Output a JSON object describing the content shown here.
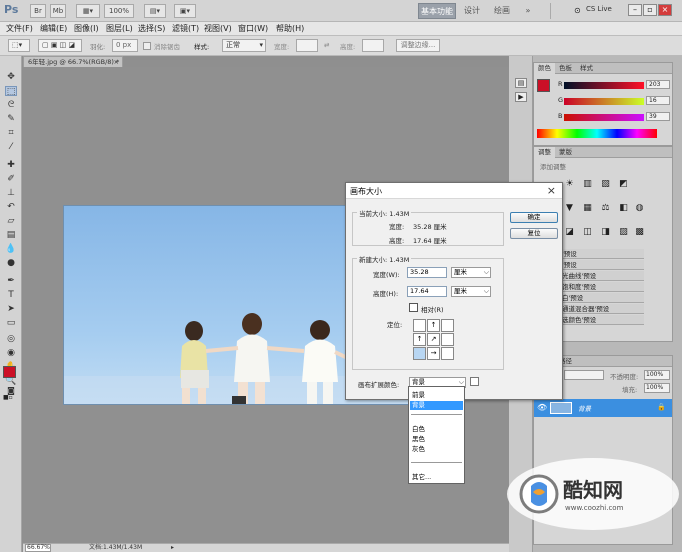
{
  "app": {
    "logo": "Ps",
    "zoom_preset": "100%",
    "workspace_tabs": [
      "基本功能",
      "设计",
      "绘画"
    ],
    "active_workspace": "基本功能",
    "cs_live": "CS Live"
  },
  "menu": [
    "文件(F)",
    "编辑(E)",
    "图像(I)",
    "图层(L)",
    "选择(S)",
    "滤镜(T)",
    "视图(V)",
    "窗口(W)",
    "帮助(H)"
  ],
  "options": {
    "feather_label": "羽化:",
    "feather_value": "0 px",
    "antialias_label": "消除锯齿",
    "style_label": "样式:",
    "style_value": "正常",
    "width_label": "宽度:",
    "height_label": "高度:",
    "refine_edge": "调整边缘..."
  },
  "document": {
    "tab_title": "6年轻.jpg @ 66.7%(RGB/8) *",
    "zoom": "66.67%",
    "status": "文档:1.43M/1.43M"
  },
  "panels": {
    "color_tabs": [
      "颜色",
      "色板",
      "样式"
    ],
    "rgb": [
      "203",
      "16",
      "39"
    ],
    "adjust_tabs": [
      "调整",
      "蒙版"
    ],
    "adjust_title": "添加调整",
    "presets": [
      "'预设",
      "'预设",
      "光曲线'预设",
      "饱和度'预设",
      "白'预设",
      "通道混合器'预设",
      "选颜色'预设"
    ],
    "layers_tabs": [
      "图层",
      "路径"
    ],
    "opacity_label": "不透明度:",
    "opacity_value": "100%",
    "fill_label": "填充:",
    "fill_value": "100%",
    "layer_name": "背景"
  },
  "dialog": {
    "title": "画布大小",
    "current_size": "当前大小: 1.43M",
    "current_width_label": "宽度:",
    "current_width_value": "35.28 厘米",
    "current_height_label": "高度:",
    "current_height_value": "17.64 厘米",
    "new_size": "新建大小: 1.43M",
    "width_label": "宽度(W):",
    "width_value": "35.28",
    "height_label": "高度(H):",
    "height_value": "17.64",
    "unit": "厘米",
    "relative_label": "相对(R)",
    "anchor_label": "定位:",
    "ok": "确定",
    "reset": "复位",
    "ext_color_label": "画布扩展颜色:",
    "ext_color_value": "背景"
  },
  "dropdown_options": [
    "前景",
    "背景",
    "白色",
    "黑色",
    "灰色",
    "其它..."
  ],
  "dropdown_selected": "背景",
  "watermark": {
    "brand": "酷知网",
    "url": "www.coozhi.com"
  },
  "colors": {
    "foreground": "#cb1027",
    "accent": "#3399ff"
  }
}
